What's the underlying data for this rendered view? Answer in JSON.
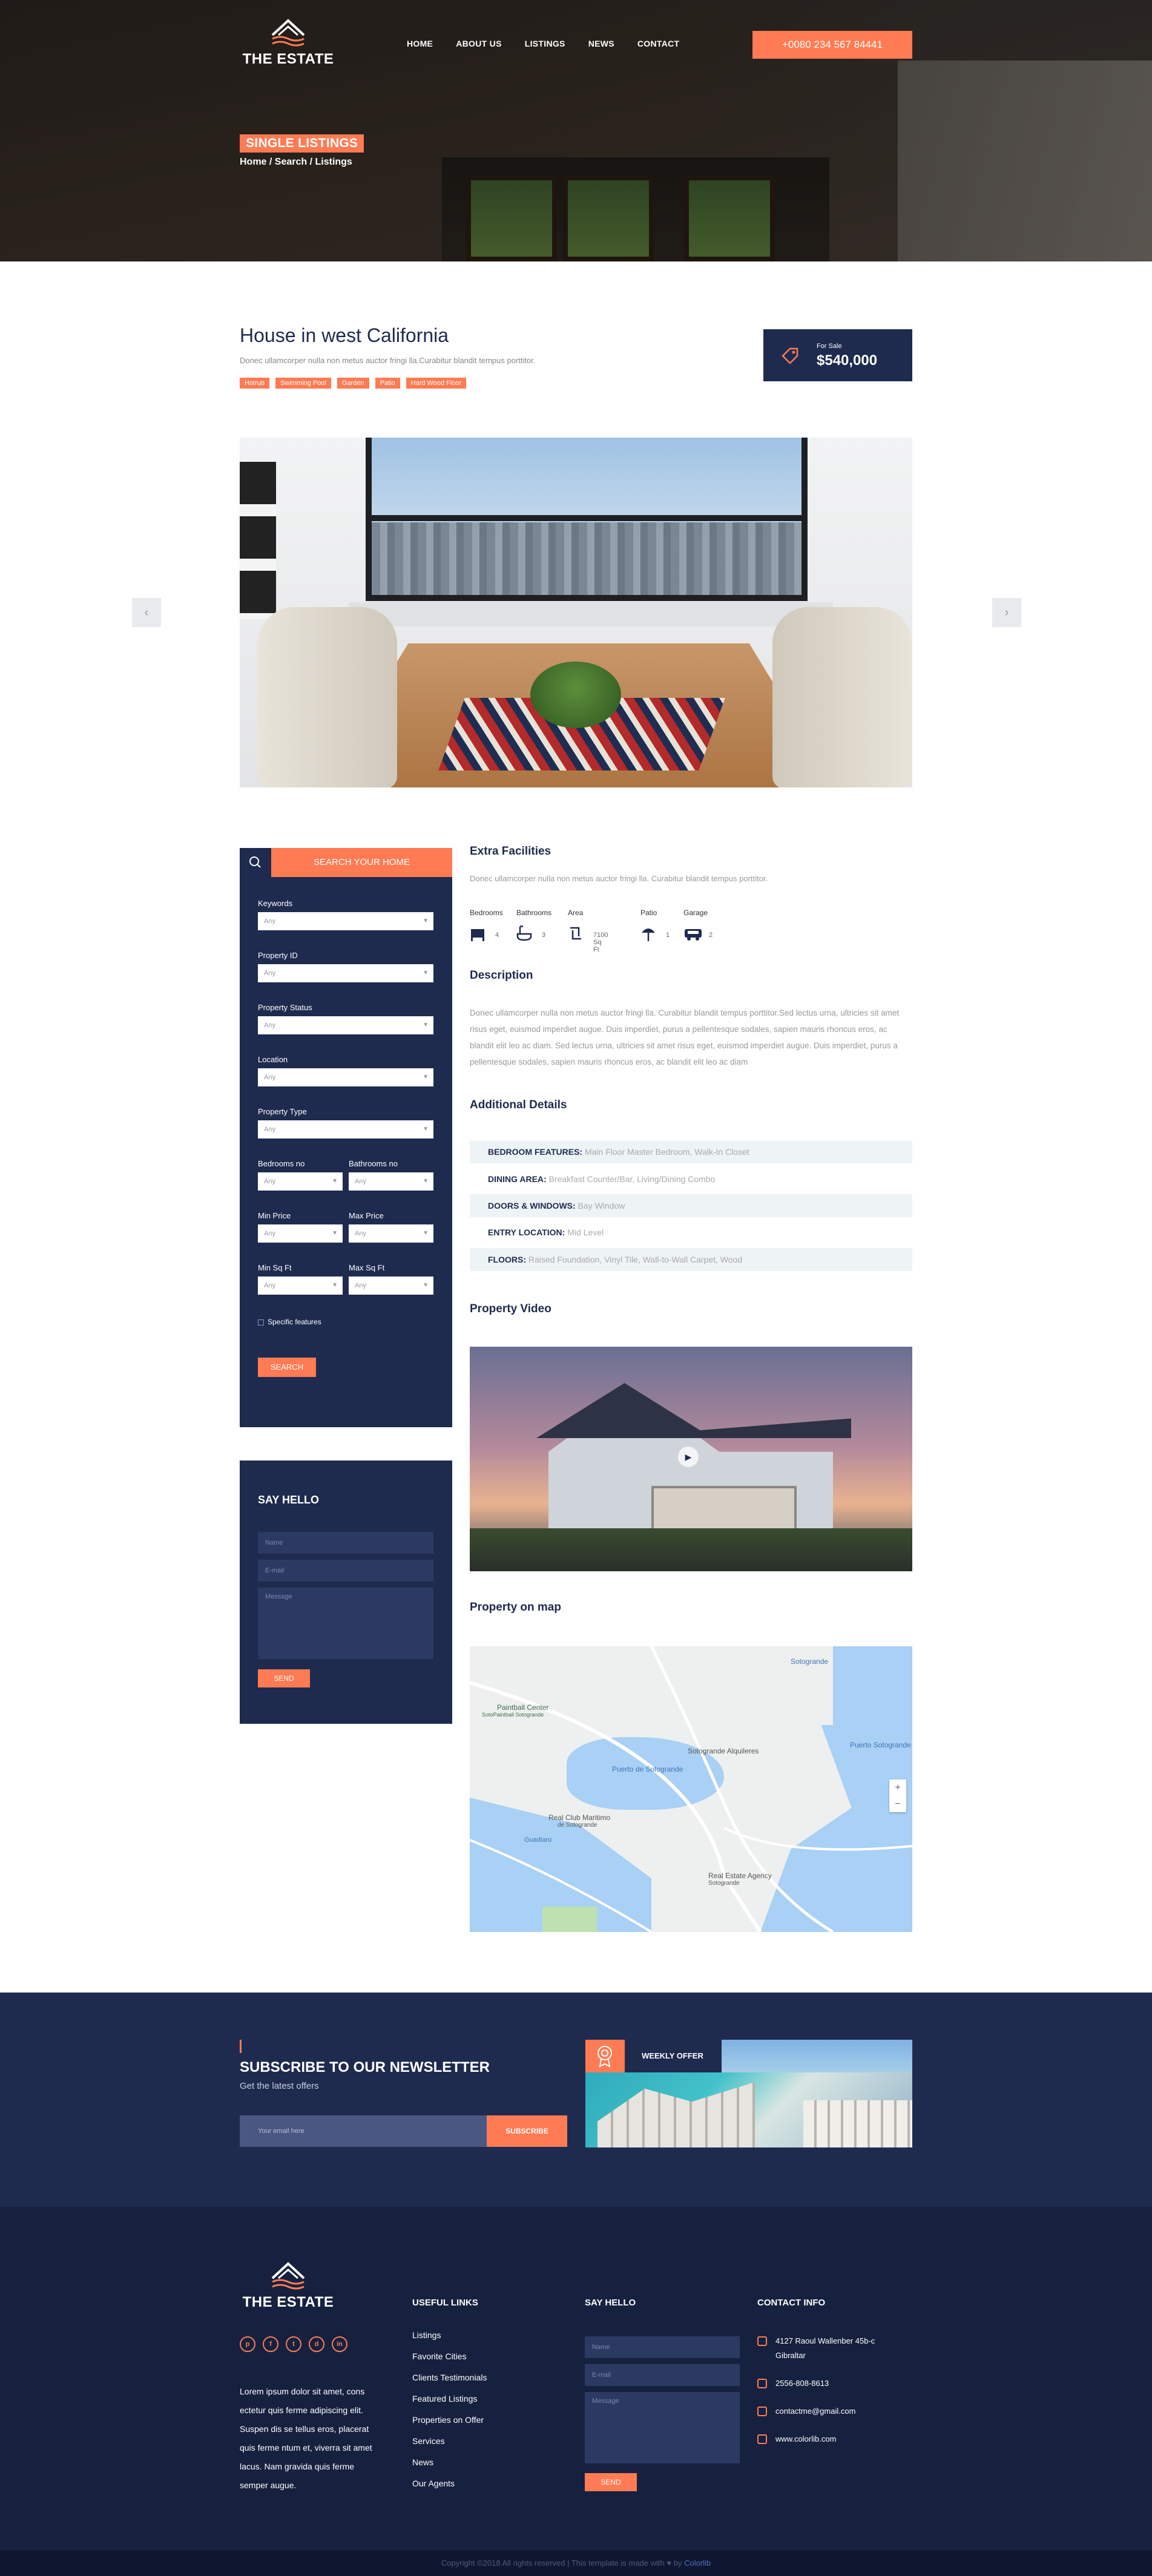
{
  "site": {
    "brand": "THE ESTATE",
    "nav": [
      "HOME",
      "ABOUT US",
      "LISTINGS",
      "NEWS",
      "CONTACT"
    ],
    "phone": "+0080 234 567 84441"
  },
  "hero": {
    "badge": "SINGLE LISTINGS",
    "breadcrumb": "Home / Search / Listings"
  },
  "listing": {
    "title": "House in west California",
    "description": "Donec ullamcorper nulla non metus auctor fringi lla.Curabitur blandit tempus porttitor.",
    "tags": [
      "Hotrub",
      "Swimming Pool",
      "Garden",
      "Patio",
      "Hard Wood Floor"
    ],
    "price_label": "For Sale",
    "price": "$540,000",
    "gallery_prev": "‹",
    "gallery_next": "›"
  },
  "search": {
    "header": "SEARCH YOUR HOME",
    "fields": [
      {
        "label": "Keywords",
        "value": "Any"
      },
      {
        "label": "Property ID",
        "value": "Any"
      },
      {
        "label": "Property Status",
        "value": "Any"
      },
      {
        "label": "Location",
        "value": "Any"
      },
      {
        "label": "Property Type",
        "value": "Any"
      }
    ],
    "pairs": [
      {
        "left_label": "Bedrooms no",
        "left_value": "Any",
        "right_label": "Bathrooms no",
        "right_value": "Any"
      },
      {
        "left_label": "Min Price",
        "left_value": "Any",
        "right_label": "Max Price",
        "right_value": "Any"
      },
      {
        "left_label": "Min Sq Ft",
        "left_value": "Any",
        "right_label": "Max Sq Ft",
        "right_value": "Any"
      }
    ],
    "specific_features": "Specific features",
    "button": "SEARCH"
  },
  "say_hello": {
    "title": "SAY HELLO",
    "name_placeholder": "Name",
    "email_placeholder": "E-mail",
    "message_placeholder": "Message",
    "button": "SEND"
  },
  "extra_facilities": {
    "title": "Extra Facilities",
    "text": "Donec ullamcorper nulla non metus auctor fringi lla. Curabitur blandit tempus porttitor.",
    "items": [
      {
        "label": "Bedrooms",
        "value": "4"
      },
      {
        "label": "Bathrooms",
        "value": "3"
      },
      {
        "label": "Area",
        "value": "7100 Sq Ft"
      },
      {
        "label": "Patio",
        "value": "1"
      },
      {
        "label": "Garage",
        "value": "2"
      }
    ]
  },
  "description": {
    "title": "Description",
    "text": "Donec ullamcorper nulla non metus auctor fringi lla. Curabitur blandit tempus porttitor.Sed lectus urna, ultricies sit amet risus eget, euismod imperdiet augue. Duis imperdiet, purus a pellentesque sodales, sapien mauris rhoncus eros, ac blandit elit leo ac diam. Sed lectus urna, ultricies sit amet risus eget, euismod imperdiet augue. Duis imperdiet, purus a pellentesque sodales, sapien mauris rhoncus eros, ac blandit elit leo ac diam"
  },
  "additional": {
    "title": "Additional Details",
    "rows": [
      {
        "key": "BEDROOM FEATURES:",
        "value": "Main Floor Master Bedroom, Walk-In Closet"
      },
      {
        "key": "DINING AREA:",
        "value": "Breakfast Counter/Bar, Living/Dining Combo"
      },
      {
        "key": "DOORS & WINDOWS:",
        "value": "Bay Window"
      },
      {
        "key": "ENTRY LOCATION:",
        "value": "Mid Level"
      },
      {
        "key": "FLOORS:",
        "value": "Raised Foundation, Vinyl Tile, Wall-to-Wall Carpet, Wood"
      }
    ]
  },
  "video": {
    "title": "Property Video",
    "play": "▶"
  },
  "map": {
    "title": "Property on map",
    "labels": {
      "paintball": "Paintball Center",
      "paintball_sub": "SotoPaintball Sotogrande",
      "sotogrande": "Sotogrande",
      "puerto_soto": "Puerto de Sotogrande",
      "sotogrande_alquileres": "Sotogrande Alquileres",
      "puerto_sotogrande": "Puerto Sotogrande",
      "real_club": "Real Club Maritimo",
      "real_club_sub": "de Sotogrande",
      "real_estate": "Real Estate Agency",
      "real_estate_sub": "Sotogrande",
      "guadiaro": "Guadiaro",
      "zoom_in": "+",
      "zoom_out": "−"
    }
  },
  "newsletter": {
    "title": "SUBSCRIBE TO OUR NEWSLETTER",
    "subtitle": "Get the latest offers",
    "placeholder": "Your email here",
    "button": "SUBSCRIBE",
    "offer": "WEEKLY OFFER"
  },
  "footer": {
    "about": "Lorem ipsum dolor sit amet, cons ectetur quis ferme adipiscing elit. Suspen dis se tellus eros, placerat quis ferme ntum et, viverra sit amet lacus. Nam gravida quis ferme semper augue.",
    "socials": [
      "p",
      "f",
      "t",
      "d",
      "in"
    ],
    "useful_links_title": "USEFUL LINKS",
    "useful_links": [
      "Listings",
      "Favorite Cities",
      "Clients Testimonials",
      "Featured Listings",
      "Properties on Offer",
      "Services",
      "News",
      "Our Agents"
    ],
    "say_hello_title": "SAY HELLO",
    "name_placeholder": "Name",
    "email_placeholder": "E-mail",
    "message_placeholder": "Message",
    "send": "SEND",
    "contact_title": "CONTACT INFO",
    "contact": [
      "4127 Raoul Wallenber 45b-c Gibraltar",
      "2556-808-8613",
      "contactme@gmail.com",
      "www.colorlib.com"
    ],
    "copyright": "Copyright ©2018 All rights reserved | This template is made with",
    "copyright_by": "by",
    "copyright_link": "Colorlib"
  },
  "colors": {
    "navy": "#1e2b4f",
    "accent": "#ff7b53"
  }
}
